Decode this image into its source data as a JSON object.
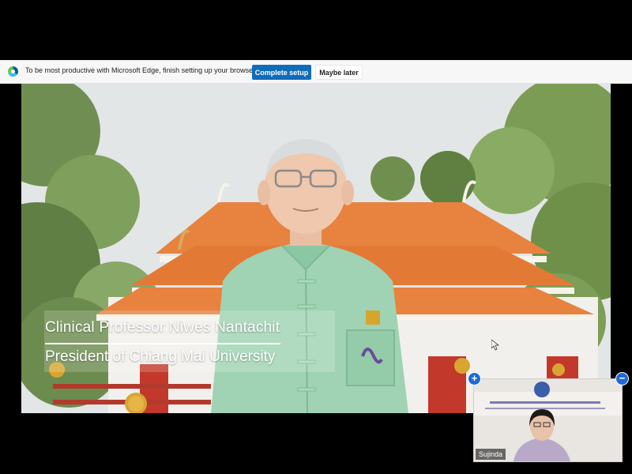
{
  "edge_banner": {
    "message": "To be most productive with Microsoft Edge, finish setting up your browser.",
    "primary_button": "Complete setup",
    "secondary_button": "Maybe later",
    "icon": "edge-logo-icon"
  },
  "video": {
    "speaker_name": "Clinical Professor Niwes Nantachit",
    "speaker_title": "President of Chiang Mai University"
  },
  "participant_tile": {
    "name": "Sujinda",
    "add_control": "+",
    "minimize_control": "−"
  },
  "colors": {
    "edge_primary": "#0f6cbd",
    "roof_orange": "#e8823f",
    "shirt_green": "#9fd3b3",
    "control_blue": "#1e6bd6"
  }
}
